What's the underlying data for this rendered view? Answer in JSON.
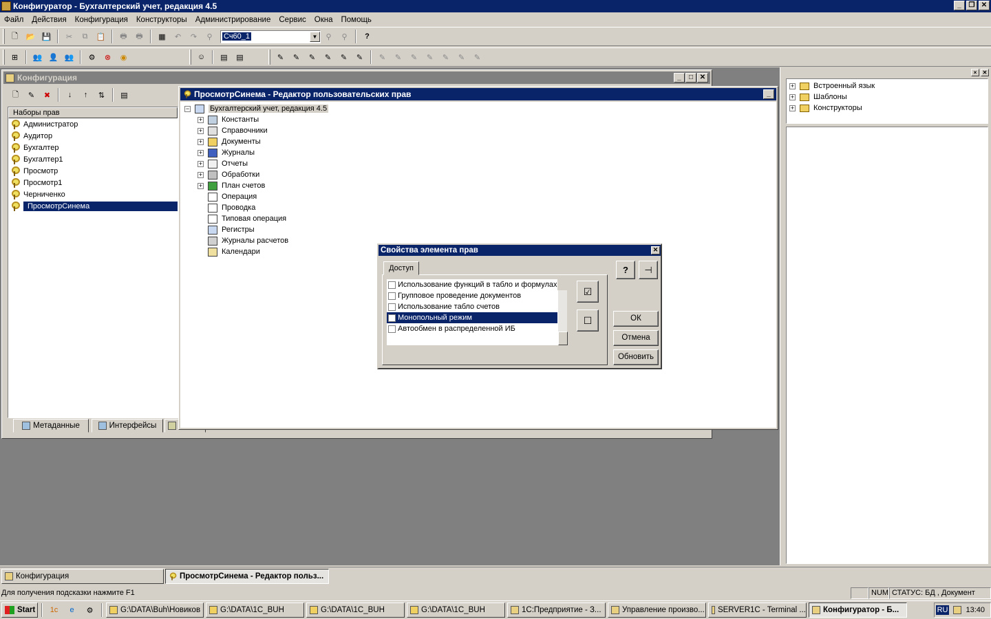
{
  "app": {
    "title": "Конфигуратор - Бухгалтерский учет, редакция 4.5",
    "window_buttons": [
      "_",
      "❐",
      "✕"
    ]
  },
  "menu": [
    "Файл",
    "Действия",
    "Конфигурация",
    "Конструкторы",
    "Администрирование",
    "Сервис",
    "Окна",
    "Помощь"
  ],
  "toolbar": {
    "combo_value": "Сч60_1"
  },
  "config_window": {
    "title": "Конфигурация",
    "list_header": "Наборы прав",
    "items": [
      "Администратор",
      "Аудитор",
      "Бухгалтер",
      "Бухгалтер1",
      "Просмотр",
      "Просмотр1",
      "Черниченко",
      "ПросмотрСинема"
    ],
    "selected_index": 7,
    "tabs": [
      "Метаданные",
      "Интерфейсы"
    ]
  },
  "editor_window": {
    "title": "ПросмотрСинема - Редактор пользовательских прав",
    "root": "Бухгалтерский учет, редакция 4.5",
    "nodes": [
      {
        "label": "Константы",
        "expandable": true
      },
      {
        "label": "Справочники",
        "expandable": true
      },
      {
        "label": "Документы",
        "expandable": true
      },
      {
        "label": "Журналы",
        "expandable": true
      },
      {
        "label": "Отчеты",
        "expandable": true
      },
      {
        "label": "Обработки",
        "expandable": true
      },
      {
        "label": "План счетов",
        "expandable": true
      },
      {
        "label": "Операция",
        "expandable": false
      },
      {
        "label": "Проводка",
        "expandable": false
      },
      {
        "label": "Типовая операция",
        "expandable": false
      },
      {
        "label": "Регистры",
        "expandable": false
      },
      {
        "label": "Журналы расчетов",
        "expandable": false
      },
      {
        "label": "Календари",
        "expandable": false
      }
    ]
  },
  "dialog": {
    "title": "Свойства элемента прав",
    "tab": "Доступ",
    "options": [
      {
        "label": "Использование функций в табло и формулах",
        "checked": false
      },
      {
        "label": "Групповое проведение документов",
        "checked": false
      },
      {
        "label": "Использование табло счетов",
        "checked": false
      },
      {
        "label": "Монопольный режим",
        "checked": false
      },
      {
        "label": "Автообмен в распределенной ИБ",
        "checked": false
      }
    ],
    "selected_index": 3,
    "buttons": {
      "ok": "ОК",
      "cancel": "Отмена",
      "refresh": "Обновить"
    }
  },
  "right_panel": {
    "items": [
      "Встроенный язык",
      "Шаблоны",
      "Конструкторы"
    ]
  },
  "window_tabs": [
    {
      "label": "Конфигурация",
      "active": false
    },
    {
      "label": "ПросмотрСинема - Редактор польз...",
      "active": true
    }
  ],
  "status": {
    "hint": "Для получения подсказки нажмите F1",
    "num": "NUM",
    "state": "СТАТУС: БД , Документ"
  },
  "taskbar": {
    "start": "Start",
    "buttons": [
      {
        "label": "G:\\DATA\\Buh\\Новиков",
        "active": false
      },
      {
        "label": "G:\\DATA\\1C_BUH",
        "active": false
      },
      {
        "label": "G:\\DATA\\1C_BUH",
        "active": false
      },
      {
        "label": "G:\\DATA\\1C_BUH",
        "active": false
      },
      {
        "label": "1С:Предприятие - З...",
        "active": false
      },
      {
        "label": "Управление произво...",
        "active": false
      },
      {
        "label": "SERVER1C - Terminal ...",
        "active": false
      },
      {
        "label": "Конфигуратор - Б...",
        "active": true
      }
    ],
    "lang": "RU",
    "clock": "13:40"
  }
}
